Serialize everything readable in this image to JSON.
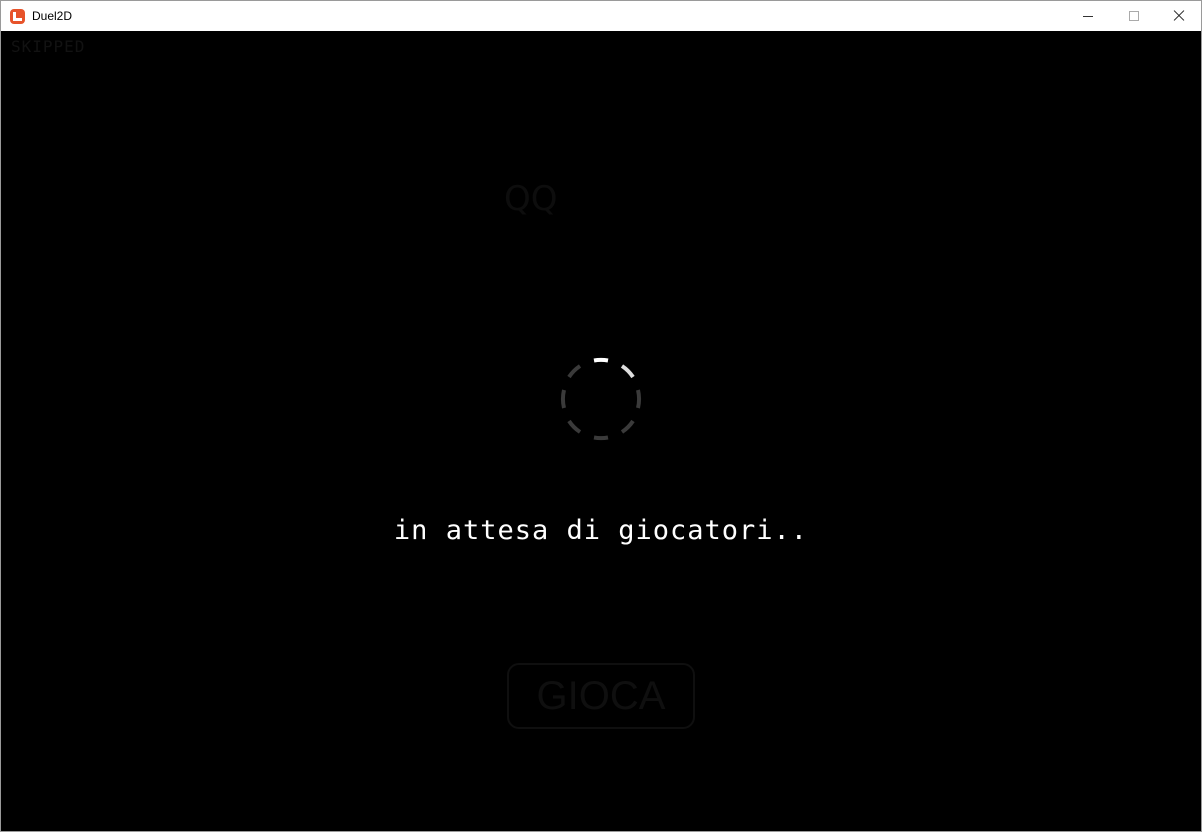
{
  "window": {
    "title": "Duel2D",
    "app_icon": "monogame-icon",
    "controls": [
      "minimize-icon",
      "maximize-icon",
      "close-icon"
    ]
  },
  "game": {
    "corner_label": "SKIPPED",
    "faded_glyph": "QQ",
    "status_text": "in attesa di giocatori..",
    "play_button_label": "GIOCA",
    "footer_text": "...",
    "colors": {
      "background": "#000000",
      "status_text": "#ffffff",
      "spinner_highlight": "#ffffff",
      "spinner_dim": "#3a3a3a"
    }
  }
}
